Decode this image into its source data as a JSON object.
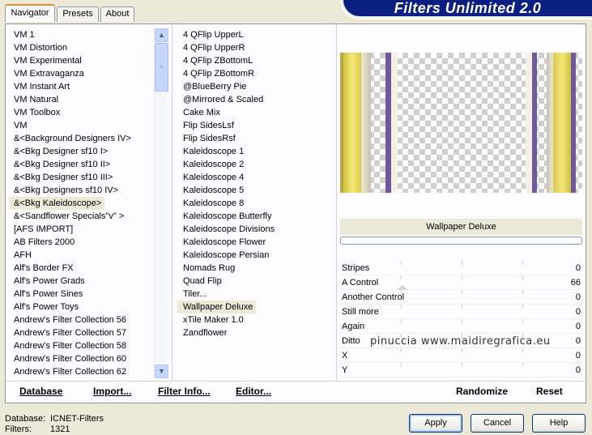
{
  "tabs": [
    {
      "label": "Navigator",
      "active": true
    },
    {
      "label": "Presets",
      "active": false
    },
    {
      "label": "About",
      "active": false
    }
  ],
  "title": "Filters Unlimited 2.0",
  "categories": [
    "VM 1",
    "VM Distortion",
    "VM Experimental",
    "VM Extravaganza",
    "VM Instant Art",
    "VM Natural",
    "VM Toolbox",
    "VM",
    "&<Background Designers IV>",
    "&<Bkg Designer sf10 I>",
    "&<Bkg Designer sf10 II>",
    "&<Bkg Designer sf10 III>",
    "&<Bkg Designers sf10 IV>",
    "&<Bkg Kaleidoscope>",
    "&<Sandflower Specials\"v\" >",
    "[AFS IMPORT]",
    "AB Filters 2000",
    "AFH",
    "Alf's Border FX",
    "Alf's Power Grads",
    "Alf's Power Sines",
    "Alf's Power Toys",
    "Andrew's Filter Collection 56",
    "Andrew's Filter Collection 57",
    "Andrew's Filter Collection 58",
    "Andrew's Filter Collection 60",
    "Andrew's Filter Collection 62"
  ],
  "selected_category": "&<Bkg Kaleidoscope>",
  "filters": [
    "4 QFlip UpperL",
    "4 QFlip UpperR",
    "4 QFlip ZBottomL",
    "4 QFlip ZBottomR",
    "@BlueBerry Pie",
    "@Mirrored & Scaled",
    "Cake Mix",
    "Flip SidesLsf",
    "Flip SidesRsf",
    "Kaleidoscope 1",
    "Kaleidoscope 2",
    "Kaleidoscope 4",
    "Kaleidoscope 5",
    "Kaleidoscope 8",
    "Kaleidoscope Butterfly",
    "Kaleidoscope Divisions",
    "Kaleidoscope Flower",
    "Kaleidoscope Persian",
    "Nomads Rug",
    "Quad Flip",
    "Tiler...",
    "Wallpaper Deluxe",
    "xTile Maker 1.0",
    "Zandflower"
  ],
  "selected_filter": "Wallpaper Deluxe",
  "filter_name": "Wallpaper Deluxe",
  "params": [
    {
      "label": "Stripes",
      "value": "0"
    },
    {
      "label": "A Control",
      "value": "66"
    },
    {
      "label": "Another Control",
      "value": "0"
    },
    {
      "label": "Still more",
      "value": "0"
    },
    {
      "label": "Again",
      "value": "0"
    },
    {
      "label": "Ditto",
      "value": "0"
    },
    {
      "label": "X",
      "value": "0"
    },
    {
      "label": "Y",
      "value": "0"
    }
  ],
  "watermark": "pinuccia www.maidiregrafica.eu",
  "bottom_buttons": {
    "database": "Database",
    "import": "Import...",
    "filter_info": "Filter Info...",
    "editor": "Editor...",
    "randomize": "Randomize",
    "reset": "Reset"
  },
  "footer": {
    "database_label": "Database:",
    "database_value": "ICNET-Filters",
    "filters_label": "Filters:",
    "filters_value": "1321"
  },
  "dialog_buttons": {
    "apply": "Apply",
    "cancel": "Cancel",
    "help": "Help"
  },
  "colors": {
    "title_bg": "#0a1f80",
    "yellow": "#e8d860",
    "purple": "#6c5a9c",
    "tab_accent": "#e68b2c"
  }
}
